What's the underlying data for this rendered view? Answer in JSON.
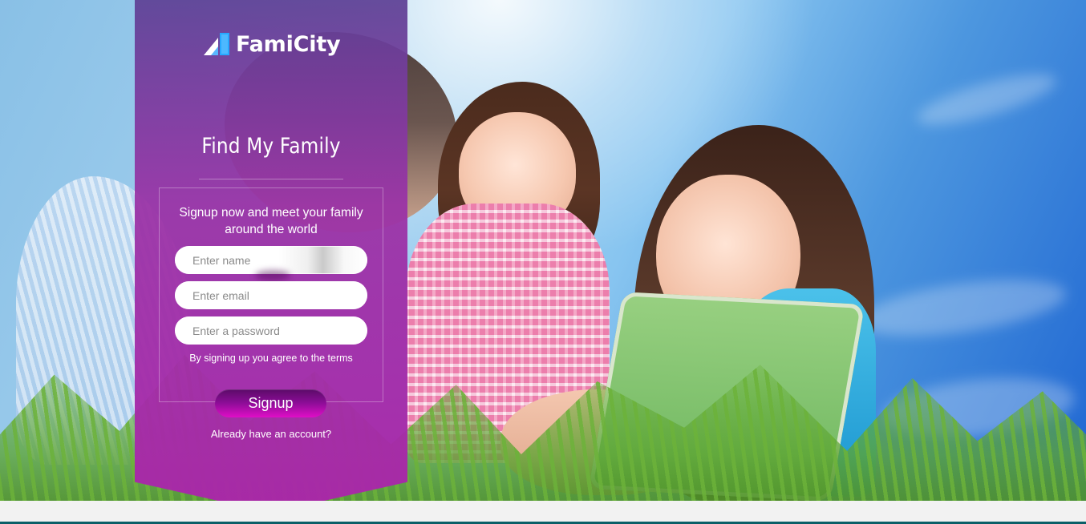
{
  "brand": {
    "name": "FamiCity",
    "logo_icon": "triangle-logo-icon",
    "accent_color": "#a12eb0"
  },
  "panel": {
    "title": "Find My Family",
    "intro": "Signup now and meet your family around the world",
    "inputs": {
      "name_placeholder": "Enter name",
      "email_placeholder": "Enter email",
      "password_placeholder": "Enter a password"
    },
    "terms_text": "By signing up you agree to the terms",
    "signup_label": "Signup",
    "account_link_label": "Already have an account?"
  }
}
